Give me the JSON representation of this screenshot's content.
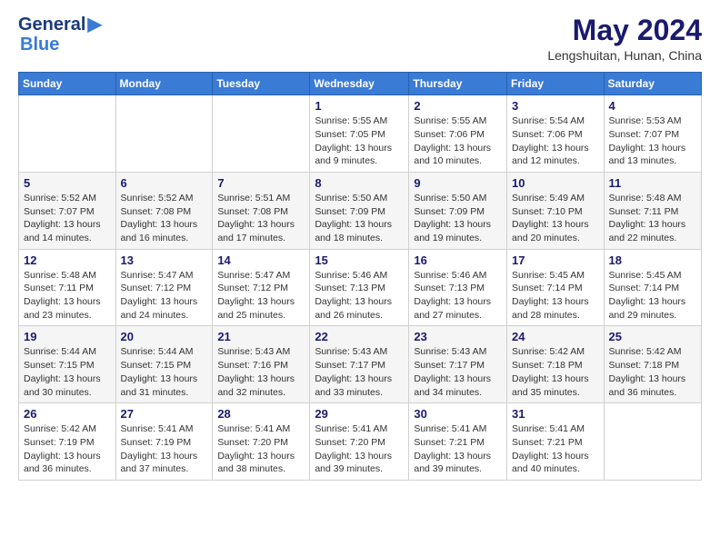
{
  "logo": {
    "line1": "General",
    "line2": "Blue",
    "icon": "▶"
  },
  "header": {
    "month_year": "May 2024",
    "location": "Lengshuitan, Hunan, China"
  },
  "weekdays": [
    "Sunday",
    "Monday",
    "Tuesday",
    "Wednesday",
    "Thursday",
    "Friday",
    "Saturday"
  ],
  "weeks": [
    [
      {
        "day": "",
        "info": ""
      },
      {
        "day": "",
        "info": ""
      },
      {
        "day": "",
        "info": ""
      },
      {
        "day": "1",
        "info": "Sunrise: 5:55 AM\nSunset: 7:05 PM\nDaylight: 13 hours\nand 9 minutes."
      },
      {
        "day": "2",
        "info": "Sunrise: 5:55 AM\nSunset: 7:06 PM\nDaylight: 13 hours\nand 10 minutes."
      },
      {
        "day": "3",
        "info": "Sunrise: 5:54 AM\nSunset: 7:06 PM\nDaylight: 13 hours\nand 12 minutes."
      },
      {
        "day": "4",
        "info": "Sunrise: 5:53 AM\nSunset: 7:07 PM\nDaylight: 13 hours\nand 13 minutes."
      }
    ],
    [
      {
        "day": "5",
        "info": "Sunrise: 5:52 AM\nSunset: 7:07 PM\nDaylight: 13 hours\nand 14 minutes."
      },
      {
        "day": "6",
        "info": "Sunrise: 5:52 AM\nSunset: 7:08 PM\nDaylight: 13 hours\nand 16 minutes."
      },
      {
        "day": "7",
        "info": "Sunrise: 5:51 AM\nSunset: 7:08 PM\nDaylight: 13 hours\nand 17 minutes."
      },
      {
        "day": "8",
        "info": "Sunrise: 5:50 AM\nSunset: 7:09 PM\nDaylight: 13 hours\nand 18 minutes."
      },
      {
        "day": "9",
        "info": "Sunrise: 5:50 AM\nSunset: 7:09 PM\nDaylight: 13 hours\nand 19 minutes."
      },
      {
        "day": "10",
        "info": "Sunrise: 5:49 AM\nSunset: 7:10 PM\nDaylight: 13 hours\nand 20 minutes."
      },
      {
        "day": "11",
        "info": "Sunrise: 5:48 AM\nSunset: 7:11 PM\nDaylight: 13 hours\nand 22 minutes."
      }
    ],
    [
      {
        "day": "12",
        "info": "Sunrise: 5:48 AM\nSunset: 7:11 PM\nDaylight: 13 hours\nand 23 minutes."
      },
      {
        "day": "13",
        "info": "Sunrise: 5:47 AM\nSunset: 7:12 PM\nDaylight: 13 hours\nand 24 minutes."
      },
      {
        "day": "14",
        "info": "Sunrise: 5:47 AM\nSunset: 7:12 PM\nDaylight: 13 hours\nand 25 minutes."
      },
      {
        "day": "15",
        "info": "Sunrise: 5:46 AM\nSunset: 7:13 PM\nDaylight: 13 hours\nand 26 minutes."
      },
      {
        "day": "16",
        "info": "Sunrise: 5:46 AM\nSunset: 7:13 PM\nDaylight: 13 hours\nand 27 minutes."
      },
      {
        "day": "17",
        "info": "Sunrise: 5:45 AM\nSunset: 7:14 PM\nDaylight: 13 hours\nand 28 minutes."
      },
      {
        "day": "18",
        "info": "Sunrise: 5:45 AM\nSunset: 7:14 PM\nDaylight: 13 hours\nand 29 minutes."
      }
    ],
    [
      {
        "day": "19",
        "info": "Sunrise: 5:44 AM\nSunset: 7:15 PM\nDaylight: 13 hours\nand 30 minutes."
      },
      {
        "day": "20",
        "info": "Sunrise: 5:44 AM\nSunset: 7:15 PM\nDaylight: 13 hours\nand 31 minutes."
      },
      {
        "day": "21",
        "info": "Sunrise: 5:43 AM\nSunset: 7:16 PM\nDaylight: 13 hours\nand 32 minutes."
      },
      {
        "day": "22",
        "info": "Sunrise: 5:43 AM\nSunset: 7:17 PM\nDaylight: 13 hours\nand 33 minutes."
      },
      {
        "day": "23",
        "info": "Sunrise: 5:43 AM\nSunset: 7:17 PM\nDaylight: 13 hours\nand 34 minutes."
      },
      {
        "day": "24",
        "info": "Sunrise: 5:42 AM\nSunset: 7:18 PM\nDaylight: 13 hours\nand 35 minutes."
      },
      {
        "day": "25",
        "info": "Sunrise: 5:42 AM\nSunset: 7:18 PM\nDaylight: 13 hours\nand 36 minutes."
      }
    ],
    [
      {
        "day": "26",
        "info": "Sunrise: 5:42 AM\nSunset: 7:19 PM\nDaylight: 13 hours\nand 36 minutes."
      },
      {
        "day": "27",
        "info": "Sunrise: 5:41 AM\nSunset: 7:19 PM\nDaylight: 13 hours\nand 37 minutes."
      },
      {
        "day": "28",
        "info": "Sunrise: 5:41 AM\nSunset: 7:20 PM\nDaylight: 13 hours\nand 38 minutes."
      },
      {
        "day": "29",
        "info": "Sunrise: 5:41 AM\nSunset: 7:20 PM\nDaylight: 13 hours\nand 39 minutes."
      },
      {
        "day": "30",
        "info": "Sunrise: 5:41 AM\nSunset: 7:21 PM\nDaylight: 13 hours\nand 39 minutes."
      },
      {
        "day": "31",
        "info": "Sunrise: 5:41 AM\nSunset: 7:21 PM\nDaylight: 13 hours\nand 40 minutes."
      },
      {
        "day": "",
        "info": ""
      }
    ]
  ]
}
